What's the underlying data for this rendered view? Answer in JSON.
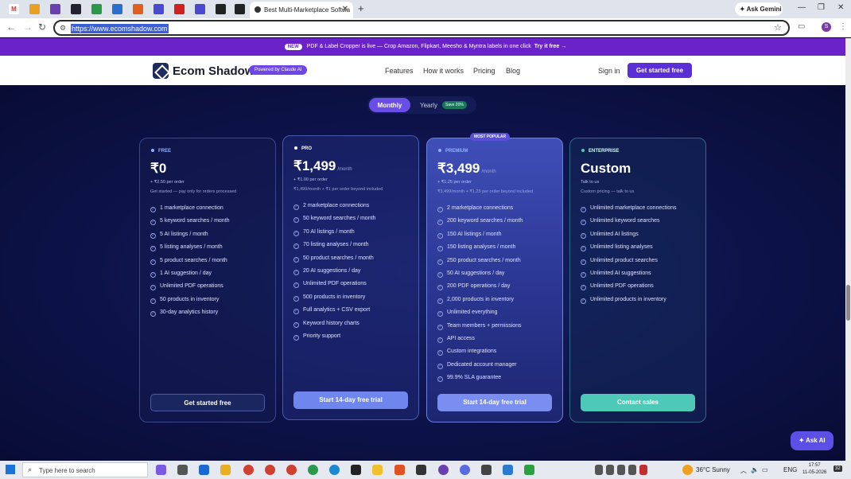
{
  "browser": {
    "active_tab_title": "Best Multi-Marketplace Softwa",
    "url": "https://www.ecomshadow.com",
    "gemini_label": "Ask Gemini",
    "avatar_letter": "S"
  },
  "banner": {
    "new_label": "NEW",
    "text": "PDF & Label Cropper is live — Crop Amazon, Flipkart, Meesho & Myntra labels in one click",
    "cta": "Try it free →"
  },
  "site_nav": {
    "brand": "Ecom Shadow",
    "powered_badge": "Powered by Claude AI",
    "links": [
      "Features",
      "How it works",
      "Pricing",
      "Blog"
    ],
    "sign_in": "Sign in",
    "get_started": "Get started free"
  },
  "billing_toggle": {
    "monthly": "Monthly",
    "yearly": "Yearly",
    "save_badge": "Save 20%"
  },
  "plans": [
    {
      "tier": "FREE",
      "price": "₹0",
      "period": "",
      "sub1": "+ ₹2.50 per order",
      "sub2": "Get started — pay only for orders processed",
      "features": [
        "1 marketplace connection",
        "5 keyword searches / month",
        "5 AI listings / month",
        "5 listing analyses / month",
        "5 product searches / month",
        "1 AI suggestion / day",
        "Unlimited PDF operations",
        "50 products in inventory",
        "30-day analytics history"
      ],
      "button": "Get started free"
    },
    {
      "tier": "PRO",
      "price": "₹1,499",
      "period": "/month",
      "sub1": "+ ₹1.00 per order",
      "sub2": "₹1,499/month + ₹1 per order beyond included",
      "features": [
        "2 marketplace connections",
        "50 keyword searches / month",
        "70 AI listings / month",
        "70 listing analyses / month",
        "50 product searches / month",
        "20 AI suggestions / day",
        "Unlimited PDF operations",
        "500 products in inventory",
        "Full analytics + CSV export",
        "Keyword history charts",
        "Priority support"
      ],
      "button": "Start 14-day free trial"
    },
    {
      "tier": "PREMIUM",
      "badge": "MOST POPULAR",
      "price": "₹3,499",
      "period": "/month",
      "sub1": "+ ₹1.25 per order",
      "sub2": "₹3,499/month + ₹1.25 per order beyond included",
      "features": [
        "2 marketplace connections",
        "200 keyword searches / month",
        "150 AI listings / month",
        "150 listing analyses / month",
        "250 product searches / month",
        "50 AI suggestions / day",
        "200 PDF operations / day",
        "2,000 products in inventory",
        "Unlimited everything",
        "Team members + permissions",
        "API access",
        "Custom integrations",
        "Dedicated account manager",
        "99.9% SLA guarantee"
      ],
      "button": "Start 14-day free trial"
    },
    {
      "tier": "ENTERPRISE",
      "price": "Custom",
      "period": "",
      "sub1": "Talk to us",
      "sub2": "Custom pricing — talk to us",
      "features": [
        "Unlimited marketplace connections",
        "Unlimited keyword searches",
        "Unlimited AI listings",
        "Unlimited listing analyses",
        "Unlimited product searches",
        "Unlimited AI suggestions",
        "Unlimited PDF operations",
        "Unlimited products in inventory"
      ],
      "button": "Contact sales"
    }
  ],
  "ask_ai": "Ask AI",
  "taskbar": {
    "search_placeholder": "Type here to search",
    "weather": "36°C  Sunny",
    "lang": "ENG",
    "time": "17:57",
    "date": "11-05-2026",
    "notif_count": "32"
  },
  "colors": {
    "accent": "#5b2fd6",
    "banner": "#6a22c9",
    "page_bg": "#0d1349",
    "enterprise_btn": "#4ec9b8"
  }
}
